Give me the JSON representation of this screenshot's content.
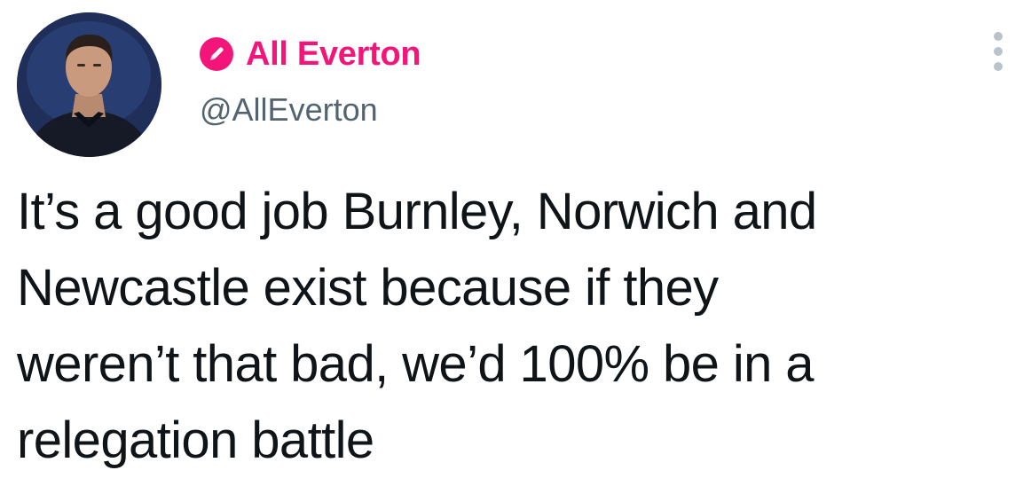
{
  "author": {
    "display_name": "All Everton",
    "handle": "@AllEverton",
    "badge_icon": "pencil-icon",
    "badge_color": "#f4157a",
    "name_color": "#f4157a"
  },
  "menu": {
    "more_icon": "more-vertical-icon"
  },
  "tweet": {
    "lines": [
      "It’s a good job Burnley, Norwich and",
      "Newcastle exist because if they",
      "weren’t that bad, we’d 100% be in a",
      "relegation battle"
    ]
  }
}
